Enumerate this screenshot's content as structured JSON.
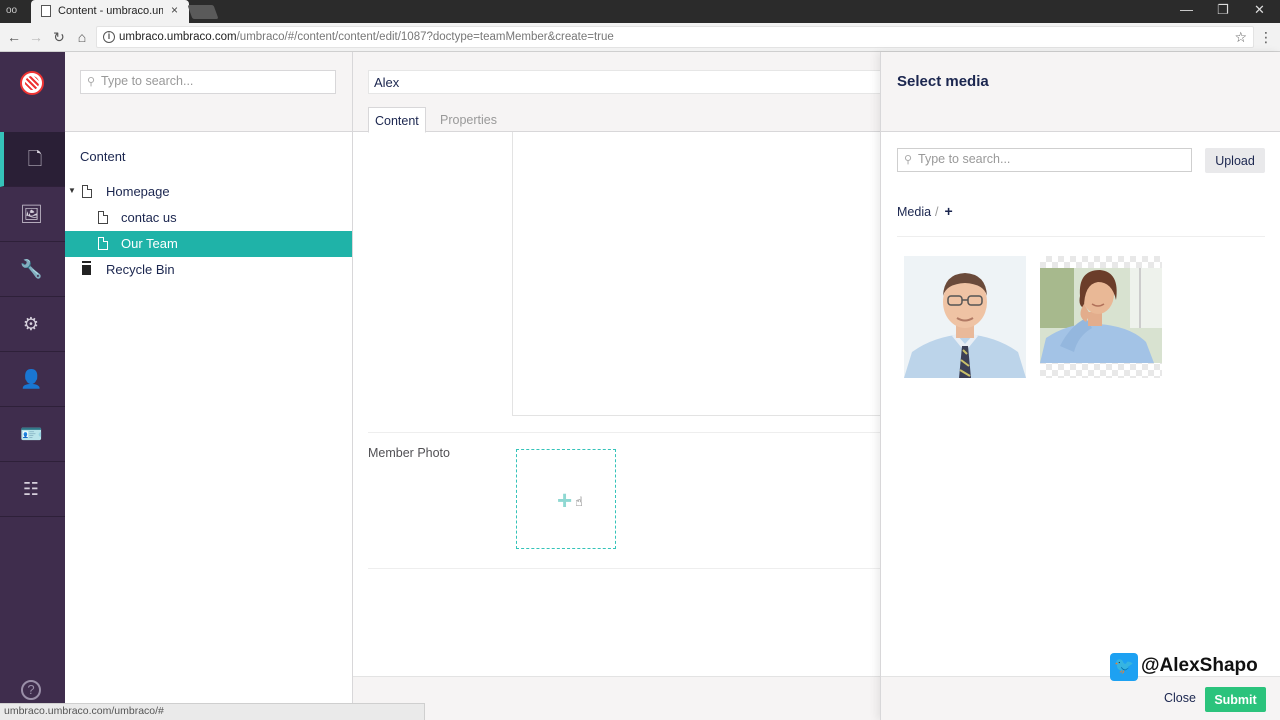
{
  "browser": {
    "tab_title": "Content - umbraco.umb",
    "tab_close": "×",
    "url_host": "umbraco.umbraco.com",
    "url_path": "/umbraco/#/content/content/edit/1087?doctype=teamMember&create=true",
    "status_url": "umbraco.umbraco.com/umbraco/#"
  },
  "icons": {
    "back": "←",
    "forward": "→",
    "reload": "↻",
    "home": "⌂",
    "star": "☆",
    "menu": "⋮",
    "minimize": "—",
    "restore": "❐",
    "close": "✕",
    "search": "⚲",
    "help": "?"
  },
  "sections": [
    {
      "name": "content",
      "icon": "document-icon",
      "glyph": "🗋"
    },
    {
      "name": "media",
      "icon": "image-icon",
      "glyph": "🖼"
    },
    {
      "name": "settings",
      "icon": "wrench-icon",
      "glyph": "🔧"
    },
    {
      "name": "developer",
      "icon": "gear-icon",
      "glyph": "⚙"
    },
    {
      "name": "users",
      "icon": "user-icon",
      "glyph": "👤"
    },
    {
      "name": "members",
      "icon": "id-card-icon",
      "glyph": "🪪"
    },
    {
      "name": "forms",
      "icon": "forms-icon",
      "glyph": "☷"
    }
  ],
  "tree": {
    "search_placeholder": "Type to search...",
    "root_label": "Content",
    "nodes": [
      {
        "label": "Homepage"
      },
      {
        "label": "contac us"
      },
      {
        "label": "Our Team"
      },
      {
        "label": "Recycle Bin"
      }
    ]
  },
  "editor": {
    "name_value": "Alex",
    "tabs": [
      "Content",
      "Properties"
    ],
    "member_photo_label": "Member Photo",
    "add_glyph": "+"
  },
  "media_picker": {
    "title": "Select media",
    "search_placeholder": "Type to search...",
    "upload_label": "Upload",
    "breadcrumb_root": "Media",
    "breadcrumb_sep": "/",
    "add_folder": "+",
    "close_label": "Close",
    "submit_label": "Submit"
  },
  "watermark": {
    "handle": "@AlexShapo"
  },
  "colors": {
    "accent": "#1fb3a8",
    "nav_bg": "#3f2d4d",
    "submit": "#2bc37c"
  }
}
